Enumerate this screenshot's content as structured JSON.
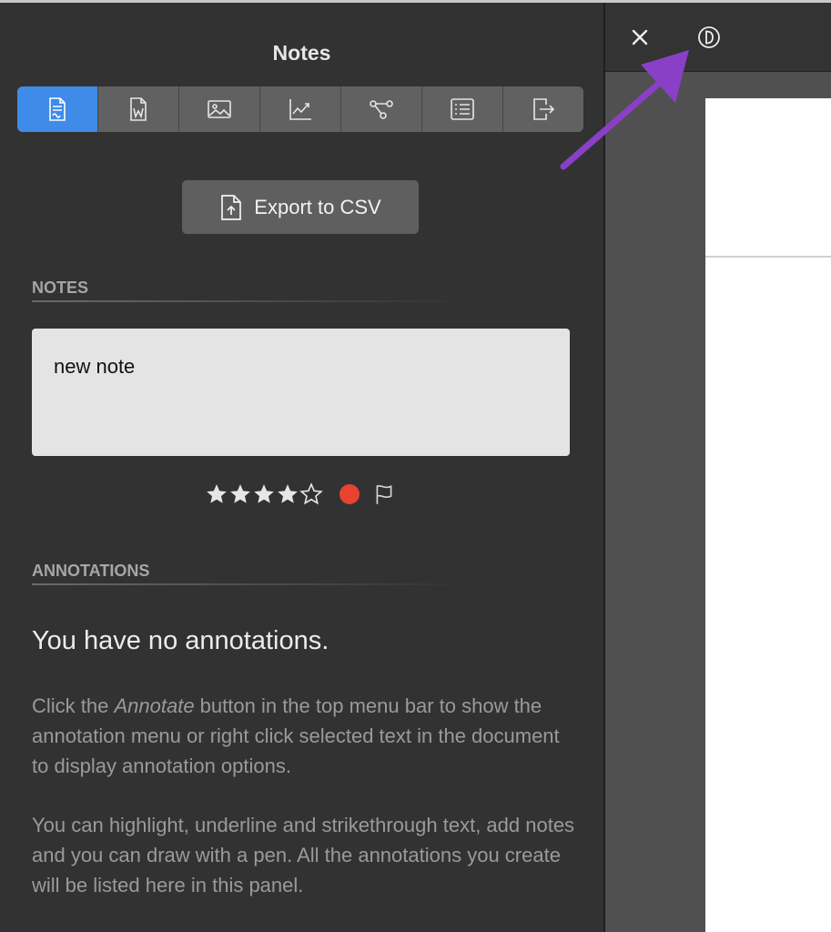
{
  "panel": {
    "title": "Notes",
    "tabs": [
      {
        "icon": "document-icon",
        "active": true
      },
      {
        "icon": "word-document-icon",
        "active": false
      },
      {
        "icon": "image-icon",
        "active": false
      },
      {
        "icon": "chart-icon",
        "active": false
      },
      {
        "icon": "workflow-icon",
        "active": false
      },
      {
        "icon": "list-icon",
        "active": false
      },
      {
        "icon": "export-icon",
        "active": false
      }
    ],
    "export_button": {
      "label": "Export to CSV",
      "icon": "file-upload-icon"
    }
  },
  "notes": {
    "section_label": "NOTES",
    "note_text": "new note",
    "rating": 4,
    "rating_max": 5,
    "color_tag": "#e8432f",
    "flag_icon": "flag-icon"
  },
  "annotations": {
    "section_label": "ANNOTATIONS",
    "empty_title": "You have no annotations.",
    "help_paragraph_1": {
      "before": "Click the ",
      "emphasis": "Annotate",
      "after": " button in the top menu bar to show the annotation menu or right click selected text in the document to display annotation options."
    },
    "help_paragraph_2": "You can highlight, underline and strikethrough text, add notes and you can draw with a pen. All the annotations you create will be listed here in this panel."
  },
  "viewer": {
    "close_icon": "close-icon",
    "contrast_icon": "contrast-mode-icon"
  },
  "colors": {
    "accent": "#3f8be8",
    "panel_background": "#323232",
    "arrow": "#8a3fc7"
  }
}
